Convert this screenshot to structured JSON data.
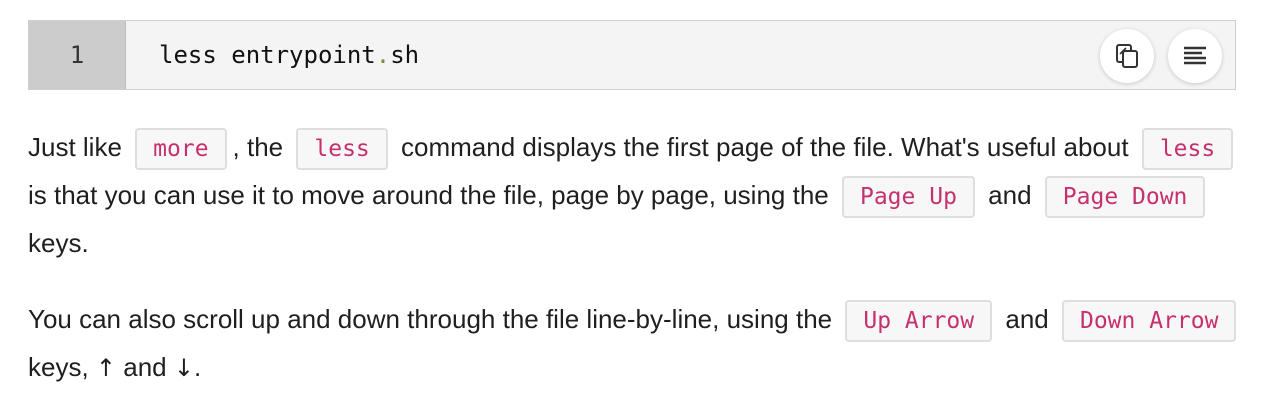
{
  "code": {
    "line_number": "1",
    "command": "less entrypoint",
    "dot": ".",
    "extension": "sh",
    "copy_icon": "copy-icon",
    "wrap_icon": "wrap-lines-icon"
  },
  "para1": {
    "t1": "Just like",
    "c1": "more",
    "t2": ", the",
    "c2": "less",
    "t3": "command displays the first page of the file. What's useful about",
    "c3": "less",
    "t4": "is that you can use it to move around the file, page by page, using the",
    "c4": "Page Up",
    "t5": "and",
    "c5": "Page Down",
    "t6": "keys."
  },
  "para2": {
    "t1": "You can also scroll up and down through the file line-by-line, using the",
    "c1": "Up Arrow",
    "t2": "and",
    "c2": "Down Arrow",
    "t3": "keys,",
    "up_arrow": "↑",
    "t4": "and",
    "down_arrow": "↓",
    "t5": "."
  },
  "colors": {
    "inline_code_text": "#c7306e",
    "code_block_bg": "#f4f4f4",
    "gutter_bg": "#cccccc"
  }
}
